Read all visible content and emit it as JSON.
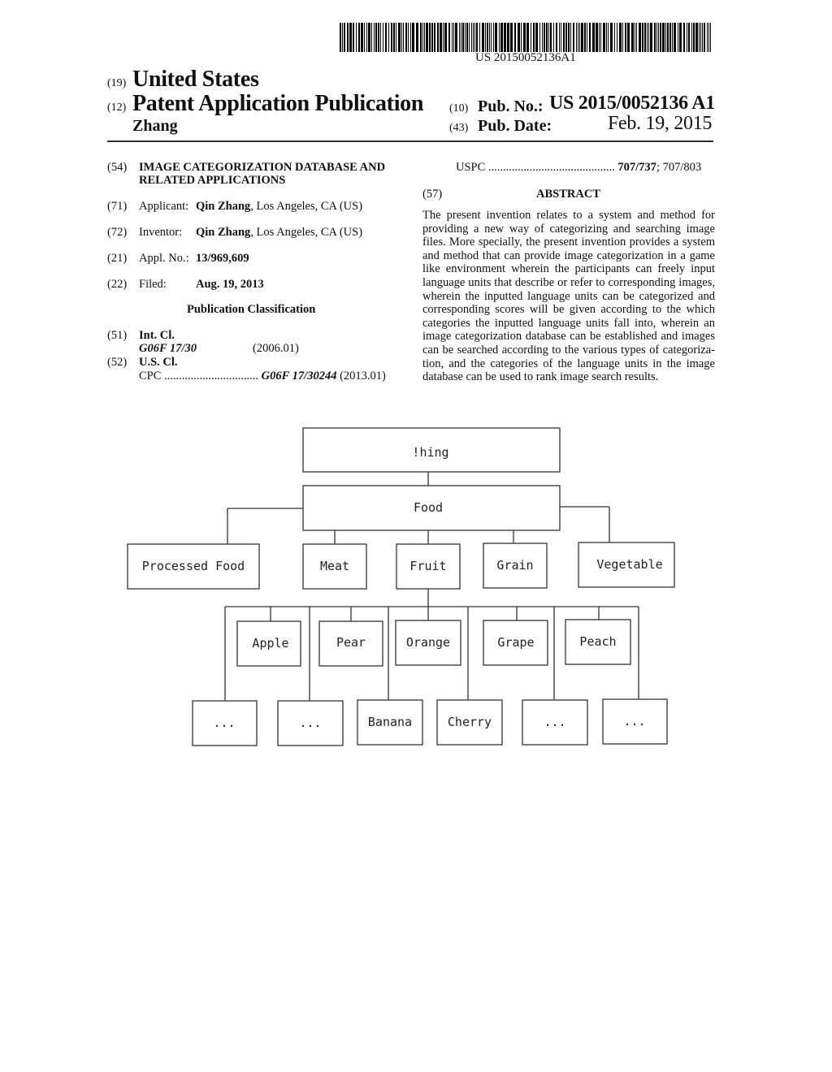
{
  "header": {
    "barcode_number": "US 20150052136A1",
    "country_code": "(19)",
    "country": "United States",
    "doc_type_code": "(12)",
    "doc_type": "Patent Application Publication",
    "inventor_surname": "Zhang",
    "pub_no_code": "(10)",
    "pub_no_label": "Pub. No.:",
    "pub_no": "US 2015/0052136 A1",
    "pub_date_code": "(43)",
    "pub_date_label": "Pub. Date:",
    "pub_date": "Feb. 19, 2015"
  },
  "biblio": {
    "title_code": "(54)",
    "title_line1": "IMAGE CATEGORIZATION DATABASE AND",
    "title_line2": "RELATED APPLICATIONS",
    "applicant_code": "(71)",
    "applicant_label": "Applicant:",
    "applicant_name": "Qin Zhang",
    "applicant_location": ", Los Angeles, CA (US)",
    "inventor_code": "(72)",
    "inventor_label": "Inventor:",
    "inventor_name": "Qin Zhang",
    "inventor_location": ", Los Angeles, CA (US)",
    "appl_code": "(21)",
    "appl_label": "Appl. No.:",
    "appl_no": "13/969,609",
    "filed_code": "(22)",
    "filed_label": "Filed:",
    "filed_date": "Aug. 19, 2013",
    "classification_heading": "Publication Classification",
    "intcl_code": "(51)",
    "intcl_label": "Int. Cl.",
    "intcl_class": "G06F 17/30",
    "intcl_version": "(2006.01)",
    "uscl_code": "(52)",
    "uscl_label": "U.S. Cl.",
    "cpc_label": "CPC",
    "cpc_dots": "................................",
    "cpc_class": "G06F 17/30244",
    "cpc_version": "(2013.01)",
    "uspc_label": "USPC",
    "uspc_dots": "...........................................",
    "uspc_primary": "707/737",
    "uspc_secondary": "; 707/803"
  },
  "abstract": {
    "code": "(57)",
    "heading": "ABSTRACT",
    "text": "The present invention relates to a system and method for providing a new way of categorizing and searching image files. More specially, the present invention provides a system and method that can provide image categorization in a game like environment wherein the participants can freely input language units that describe or refer to corresponding images, wherein the inputted language units can be categorized and corresponding scores will be given according to the which categories the inputted language units fall into, wherein an image categorization database can be established and images can be searched according to the various types of categoriza-tion, and the categories of the language units in the image database can be used to rank image search results."
  },
  "diagram": {
    "root": "!hing",
    "level1": "Food",
    "level2": [
      "Processed Food",
      "Meat",
      "Fruit",
      "Grain",
      "Vegetable"
    ],
    "fruits_row1": [
      "Apple",
      "Pear",
      "Orange",
      "Grape",
      "Peach"
    ],
    "fruits_row2": [
      "...",
      "...",
      "Banana",
      "Cherry",
      "...",
      "..."
    ]
  }
}
